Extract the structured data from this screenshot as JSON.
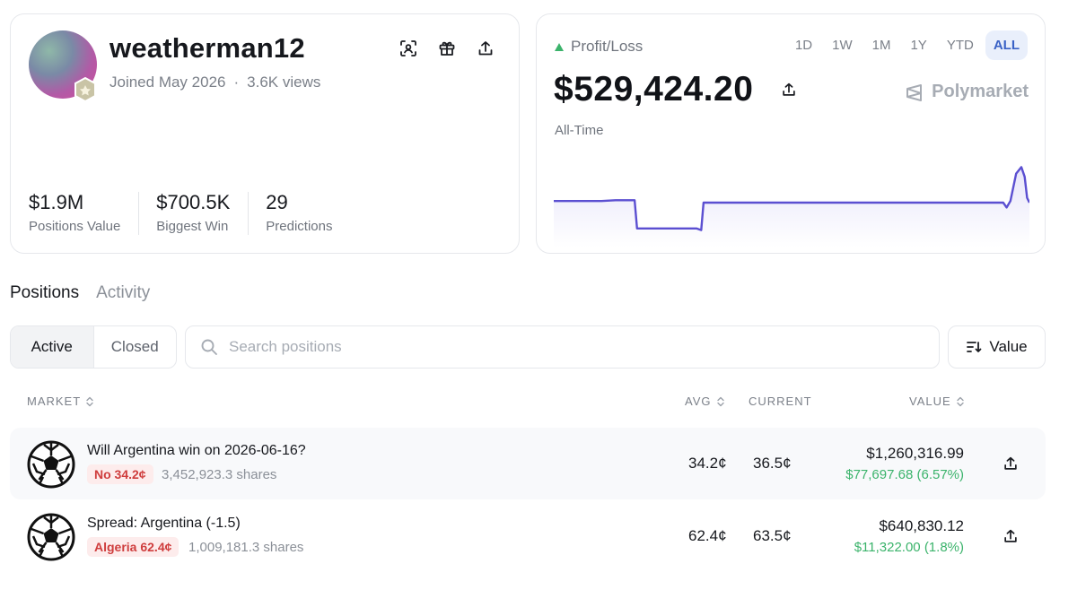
{
  "profile": {
    "username": "weatherman12",
    "joined": "Joined May 2026",
    "separator": "·",
    "views": "3.6K views",
    "actions": [
      "scan-icon",
      "gift-icon",
      "share-icon"
    ],
    "stats": [
      {
        "value": "$1.9M",
        "label": "Positions Value"
      },
      {
        "value": "$700.5K",
        "label": "Biggest Win"
      },
      {
        "value": "29",
        "label": "Predictions"
      }
    ]
  },
  "pnl": {
    "label": "Profit/Loss",
    "trend_icon": "triangle-up-icon",
    "ranges": [
      "1D",
      "1W",
      "1M",
      "1Y",
      "YTD",
      "ALL"
    ],
    "active_range": "ALL",
    "value": "$529,424.20",
    "brand": "Polymarket",
    "period": "All-Time",
    "line_color": "#5b4fd1",
    "chart_data": {
      "type": "line",
      "title": "",
      "xlabel": "",
      "ylabel": "",
      "x": [
        0,
        5,
        10,
        13,
        14,
        17,
        17.5,
        30,
        31,
        31.5,
        50,
        75,
        94.5,
        95.2,
        96,
        97.2,
        98.3,
        99,
        99.5,
        100
      ],
      "y": [
        0.52,
        0.52,
        0.52,
        0.53,
        0.53,
        0.53,
        0.18,
        0.18,
        0.16,
        0.5,
        0.5,
        0.5,
        0.5,
        0.44,
        0.52,
        0.86,
        0.94,
        0.82,
        0.56,
        0.5
      ],
      "grid": false
    }
  },
  "tabs": [
    {
      "label": "Positions",
      "active": true
    },
    {
      "label": "Activity",
      "active": false
    }
  ],
  "filters": {
    "segments": [
      "Active",
      "Closed"
    ],
    "active_segment": "Active",
    "search_placeholder": "Search positions",
    "sort_label": "Value"
  },
  "table": {
    "headers": {
      "market": "MARKET",
      "avg": "AVG",
      "current": "CURRENT",
      "value": "VALUE"
    },
    "rows": [
      {
        "title": "Will Argentina win on 2026-06-16?",
        "outcome": "No 34.2¢",
        "shares": "3,452,923.3 shares",
        "avg": "34.2¢",
        "current": "36.5¢",
        "value": "$1,260,316.99",
        "change": "$77,697.68 (6.57%)"
      },
      {
        "title": "Spread: Argentina (-1.5)",
        "outcome": "Algeria 62.4¢",
        "shares": "1,009,181.3 shares",
        "avg": "62.4¢",
        "current": "63.5¢",
        "value": "$640,830.12",
        "change": "$11,322.00 (1.8%)"
      }
    ]
  }
}
